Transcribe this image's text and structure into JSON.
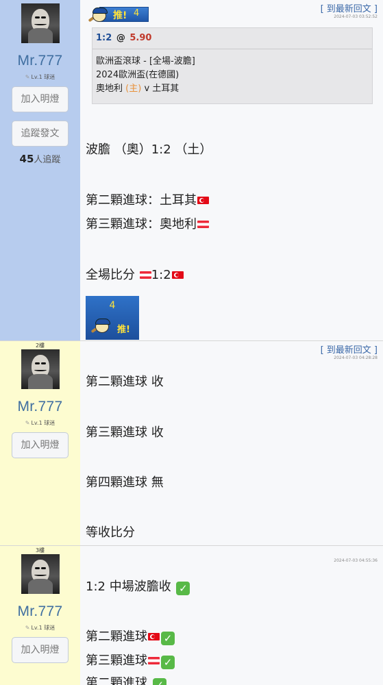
{
  "posts": [
    {
      "floor": "",
      "user": {
        "name": "Mr.777",
        "level": "Lv.1 球迷"
      },
      "buttons": {
        "light": "加入明燈",
        "follow": "追蹤發文"
      },
      "followers": {
        "count": "45",
        "suffix": "人追蹤"
      },
      "reply_link": "[ 到最新回文 ]",
      "timestamp": "2024-07-03 03:52:52",
      "push": {
        "label": "推!",
        "count": "4"
      },
      "bet": {
        "selection": "1:2",
        "at": "@",
        "odds": "5.90",
        "market": "歐洲盃滾球 - [全場-波膽]",
        "league": "2024歐洲盃(在德國)",
        "home_team": "奧地利",
        "home_tag": "(主)",
        "vs": "v",
        "away_team": "土耳其"
      },
      "lines": [
        "波膽 （奧）1:2 （土）",
        "第二顆進球：土耳其",
        "第三顆進球：奧地利",
        "全場比分 ",
        "1:2"
      ]
    },
    {
      "floor": "2樓",
      "user": {
        "name": "Mr.777",
        "level": "Lv.1 球迷"
      },
      "buttons": {
        "light": "加入明燈"
      },
      "reply_link": "[ 到最新回文 ]",
      "timestamp": "2024-07-03 04:28:28",
      "lines": [
        "第二顆進球 收",
        "第三顆進球 收",
        "第四顆進球 無",
        "等收比分"
      ]
    },
    {
      "floor": "3樓",
      "user": {
        "name": "Mr.777",
        "level": "Lv.1 球迷"
      },
      "buttons": {
        "light": "加入明燈"
      },
      "timestamp": "2024-07-03 04:55:36",
      "lines": [
        "1:2 中場波膽收",
        "第二顆進球",
        "第三顆進球",
        "第二顆進球"
      ]
    }
  ],
  "icons": {
    "check": "✓",
    "check_color": "#58b947",
    "flag_turkey": "turkey-flag-icon",
    "flag_austria": "austria-flag-icon"
  },
  "colors": {
    "side_blue": "#b7ccee",
    "side_yellow": "#fdfcd0",
    "username": "#3f6ea0",
    "link": "#3a68a8",
    "odds": "#c0392b"
  }
}
